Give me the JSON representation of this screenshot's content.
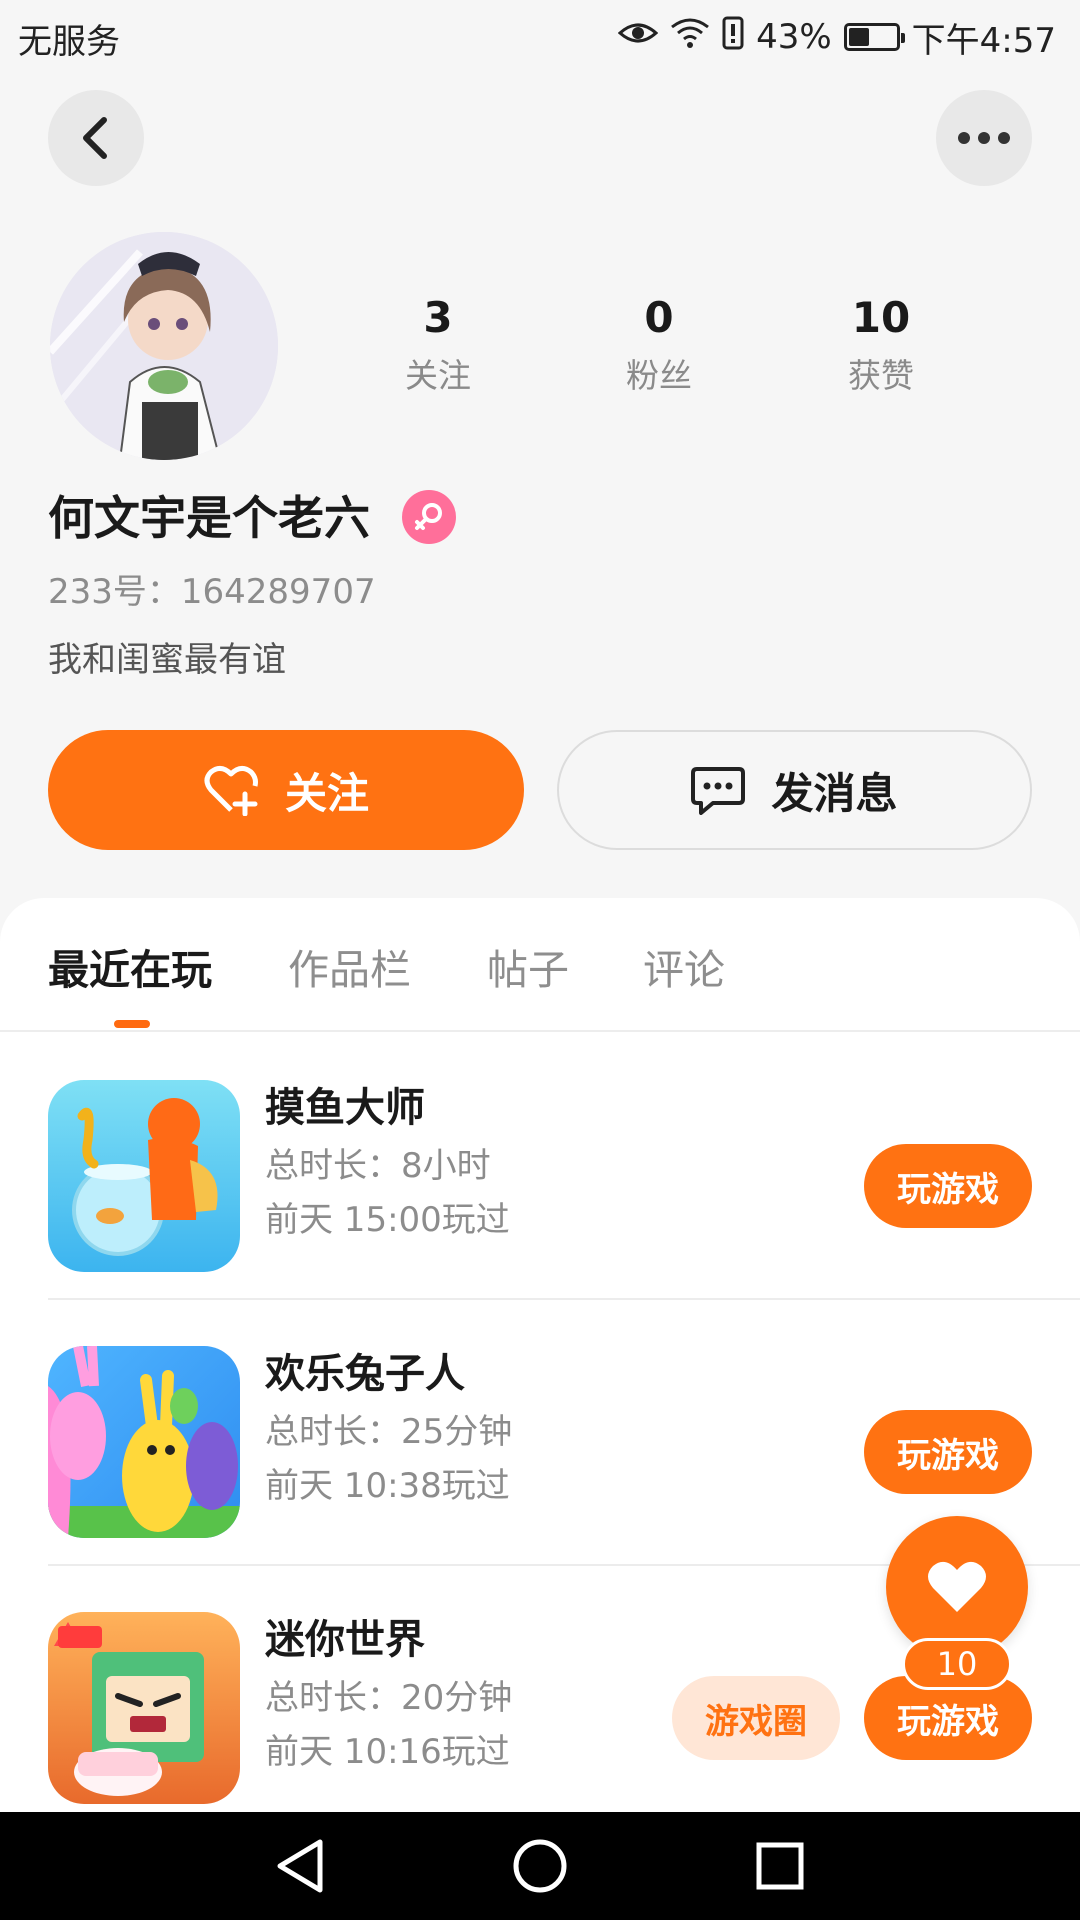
{
  "status_bar": {
    "carrier": "无服务",
    "battery_percent": "43%",
    "battery_level": 0.43,
    "time": "下午4:57",
    "icons": [
      "eye-icon",
      "wifi-icon",
      "alert-icon",
      "battery-icon"
    ]
  },
  "profile": {
    "stats": [
      {
        "value": "3",
        "label": "关注"
      },
      {
        "value": "0",
        "label": "粉丝"
      },
      {
        "value": "10",
        "label": "获赞"
      }
    ],
    "username": "何文宇是个老六",
    "gender_icon": "female-icon",
    "id_line": "233号：164289707",
    "bio": "我和闺蜜最有谊"
  },
  "actions": {
    "follow_label": "关注",
    "message_label": "发消息"
  },
  "tabs": [
    {
      "label": "最近在玩",
      "active": true
    },
    {
      "label": "作品栏",
      "active": false
    },
    {
      "label": "帖子",
      "active": false
    },
    {
      "label": "评论",
      "active": false
    }
  ],
  "games": [
    {
      "name": "摸鱼大师",
      "total_time": "总时长：8小时",
      "last_played": "前天 15:00玩过",
      "play_label": "玩游戏"
    },
    {
      "name": "欢乐兔子人",
      "total_time": "总时长：25分钟",
      "last_played": "前天 10:38玩过",
      "play_label": "玩游戏"
    },
    {
      "name": "迷你世界",
      "total_time": "总时长：20分钟",
      "last_played": "前天 10:16玩过",
      "play_label": "玩游戏",
      "circle_label": "游戏圈"
    }
  ],
  "like_fab": {
    "count": "10"
  },
  "colors": {
    "accent": "#ff7212",
    "accent_light": "#ffe6d6",
    "female": "#ff6f9a"
  }
}
